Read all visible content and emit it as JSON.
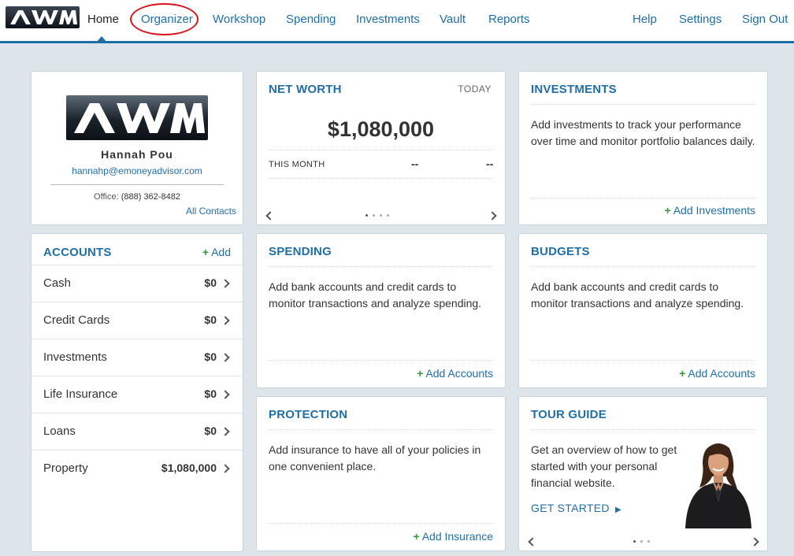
{
  "nav": {
    "logo_text": "AWM",
    "items": [
      {
        "label": "Home"
      },
      {
        "label": "Organizer"
      },
      {
        "label": "Workshop"
      },
      {
        "label": "Spending"
      },
      {
        "label": "Investments"
      },
      {
        "label": "Vault"
      },
      {
        "label": "Reports"
      }
    ],
    "right": [
      {
        "label": "Help"
      },
      {
        "label": "Settings"
      },
      {
        "label": "Sign Out"
      }
    ],
    "active": "Home",
    "highlighted": "Organizer",
    "accent": "#1f6fa6"
  },
  "profile": {
    "logo_text": "AWM",
    "name": "Hannah Pou",
    "email": "hannahp@emoneyadvisor.com",
    "office_label": "Office:",
    "office_phone": "(888) 362-8482",
    "all_contacts": "All Contacts"
  },
  "accounts": {
    "title": "ACCOUNTS",
    "add_label": "Add",
    "rows": [
      {
        "name": "Cash",
        "value": "$0"
      },
      {
        "name": "Credit Cards",
        "value": "$0"
      },
      {
        "name": "Investments",
        "value": "$0"
      },
      {
        "name": "Life Insurance",
        "value": "$0"
      },
      {
        "name": "Loans",
        "value": "$0"
      },
      {
        "name": "Property",
        "value": "$1,080,000"
      }
    ]
  },
  "net_worth": {
    "title": "NET WORTH",
    "period": "TODAY",
    "amount": "$1,080,000",
    "month_label": "THIS MONTH",
    "month_change": "--",
    "month_pct": "--"
  },
  "investments": {
    "title": "INVESTMENTS",
    "text": "Add investments to track your performance over time and monitor portfolio balances daily.",
    "action": "Add Investments"
  },
  "spending": {
    "title": "SPENDING",
    "text": "Add bank accounts and credit cards to monitor transactions and analyze spending.",
    "action": "Add Accounts"
  },
  "budgets": {
    "title": "BUDGETS",
    "text": "Add bank accounts and credit cards to monitor transactions and analyze spending.",
    "action": "Add Accounts"
  },
  "protection": {
    "title": "PROTECTION",
    "text": "Add insurance to have all of your policies in one convenient place.",
    "action": "Add Insurance"
  },
  "tour": {
    "title": "TOUR GUIDE",
    "text": "Get an overview of how to get started with your personal financial website.",
    "action": "GET STARTED"
  }
}
